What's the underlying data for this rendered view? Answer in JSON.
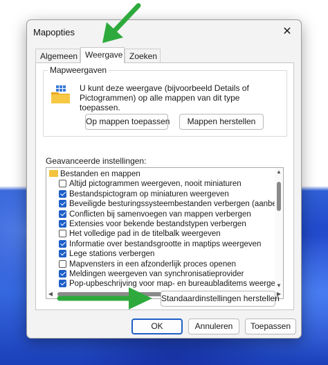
{
  "window": {
    "title": "Mapopties",
    "close_glyph": "✕"
  },
  "tabs": [
    {
      "label": "Algemeen",
      "active": false
    },
    {
      "label": "Weergave",
      "active": true
    },
    {
      "label": "Zoeken",
      "active": false
    }
  ],
  "folder_views": {
    "group_label": "Mapweergaven",
    "icon": "folder-views-icon",
    "description": "U kunt deze weergave (bijvoorbeeld Details of Pictogrammen) op alle mappen van dit type toepassen.",
    "apply_button": "Op mappen toepassen",
    "reset_button": "Mappen herstellen"
  },
  "advanced": {
    "label": "Geavanceerde instellingen:",
    "root_label": "Bestanden en mappen",
    "items": [
      {
        "label": "Altijd pictogrammen weergeven, nooit miniaturen",
        "checked": false
      },
      {
        "label": "Bestandspictogram op miniaturen weergeven",
        "checked": true
      },
      {
        "label": "Beveiligde besturingssysteembestanden verbergen (aanbe",
        "checked": true
      },
      {
        "label": "Conflicten bij samenvoegen van mappen verbergen",
        "checked": true
      },
      {
        "label": "Extensies voor bekende bestandstypen verbergen",
        "checked": true
      },
      {
        "label": "Het volledige pad in de titelbalk weergeven",
        "checked": false
      },
      {
        "label": "Informatie over bestandsgrootte in maptips weergeven",
        "checked": true
      },
      {
        "label": "Lege stations verbergen",
        "checked": true
      },
      {
        "label": "Mapvensters in een afzonderlijk proces openen",
        "checked": false
      },
      {
        "label": "Meldingen weergeven van synchronisatieprovider",
        "checked": true
      },
      {
        "label": "Pop-upbeschrijving voor map- en bureaubladitems weerge",
        "checked": true
      }
    ],
    "restore_defaults_button": "Standaardinstellingen herstellen"
  },
  "footer": {
    "ok": "OK",
    "cancel": "Annuleren",
    "apply": "Toepassen"
  },
  "colors": {
    "accent": "#1e5fc8",
    "annotation_arrow": "#2eaa3c"
  }
}
